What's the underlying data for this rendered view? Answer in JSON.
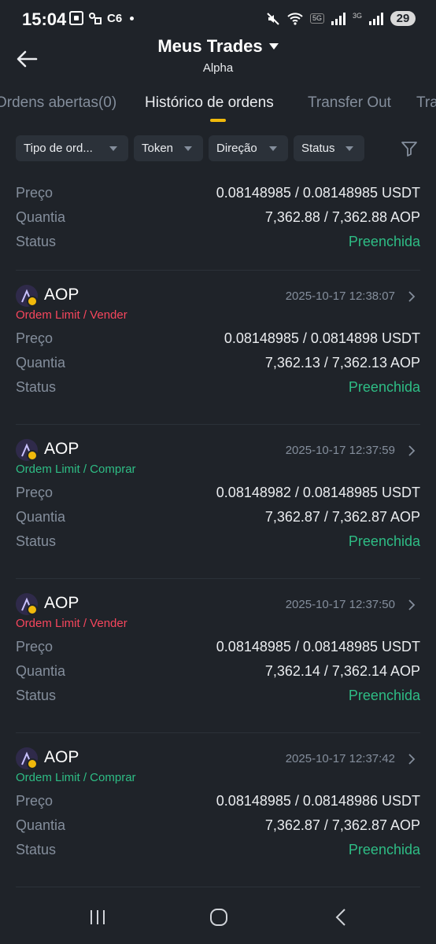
{
  "status_bar": {
    "time": "15:04",
    "carrier_text": "C6",
    "net_5g": "5G",
    "net_3g": "3G",
    "battery": "29"
  },
  "header": {
    "title": "Meus Trades",
    "subtitle": "Alpha"
  },
  "tabs": [
    {
      "label": "Ordens abertas(0)"
    },
    {
      "label": "Histórico de ordens"
    },
    {
      "label": "Transfer Out"
    },
    {
      "label": "Tra"
    }
  ],
  "filters": [
    {
      "label": "Tipo de ord..."
    },
    {
      "label": "Token"
    },
    {
      "label": "Direção"
    },
    {
      "label": "Status"
    }
  ],
  "labels": {
    "price": "Preço",
    "quantity": "Quantia",
    "status": "Status"
  },
  "colors": {
    "buy": "#2ebd85",
    "sell": "#f6465d",
    "filled": "#2ebd85",
    "accent": "#f0b90b"
  },
  "partial_order": {
    "price": "0.08148985 / 0.08148985 USDT",
    "quantity": "7,362.88 / 7,362.88 AOP",
    "status": "Preenchida"
  },
  "orders": [
    {
      "coin": "AOP",
      "time": "2025-10-17 12:38:07",
      "type": "Ordem Limit / Vender",
      "side": "sell",
      "price": "0.08148985 / 0.0814898 USDT",
      "quantity": "7,362.13 / 7,362.13 AOP",
      "status": "Preenchida"
    },
    {
      "coin": "AOP",
      "time": "2025-10-17 12:37:59",
      "type": "Ordem Limit / Comprar",
      "side": "buy",
      "price": "0.08148982 / 0.08148985 USDT",
      "quantity": "7,362.87 / 7,362.87 AOP",
      "status": "Preenchida"
    },
    {
      "coin": "AOP",
      "time": "2025-10-17 12:37:50",
      "type": "Ordem Limit / Vender",
      "side": "sell",
      "price": "0.08148985 / 0.08148985 USDT",
      "quantity": "7,362.14 / 7,362.14 AOP",
      "status": "Preenchida"
    },
    {
      "coin": "AOP",
      "time": "2025-10-17 12:37:42",
      "type": "Ordem Limit / Comprar",
      "side": "buy",
      "price": "0.08148985 / 0.08148986 USDT",
      "quantity": "7,362.87 / 7,362.87 AOP",
      "status": "Preenchida"
    }
  ]
}
